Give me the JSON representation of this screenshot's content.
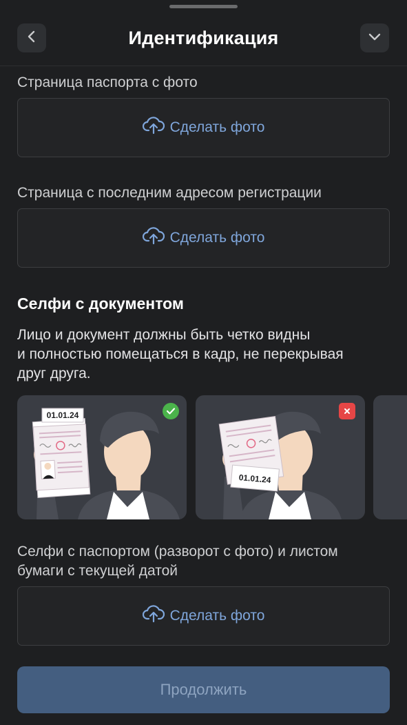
{
  "header": {
    "title": "Идентификация",
    "back_icon": "chevron-left-icon",
    "collapse_icon": "chevron-down-icon"
  },
  "fields": [
    {
      "label": "Страница паспорта с фото",
      "button": "Сделать фото"
    },
    {
      "label": "Страница с последним адресом регистрации",
      "button": "Сделать фото"
    }
  ],
  "selfie": {
    "title": "Селфи с документом",
    "description_line1": "Лицо и документ должны быть четко видны",
    "description_line2": "и полностью помещаться в кадр, не перекрывая",
    "description_line3": "друг друга.",
    "examples": [
      {
        "date": "01.01.24",
        "status": "correct",
        "badge_icon": "check-icon",
        "badge_color": "#4bb34b"
      },
      {
        "date": "01.01.24",
        "status": "incorrect",
        "badge_icon": "cross-icon",
        "badge_color": "#e64646"
      }
    ],
    "field_label_line1": "Селфи с паспортом (разворот с фото) и листом",
    "field_label_line2": "бумаги с текущей датой",
    "button": "Сделать фото"
  },
  "footer": {
    "continue_label": "Продолжить"
  },
  "colors": {
    "background": "#1e1f21",
    "accent_text": "#7fa6db",
    "continue_bg": "#445e80"
  }
}
